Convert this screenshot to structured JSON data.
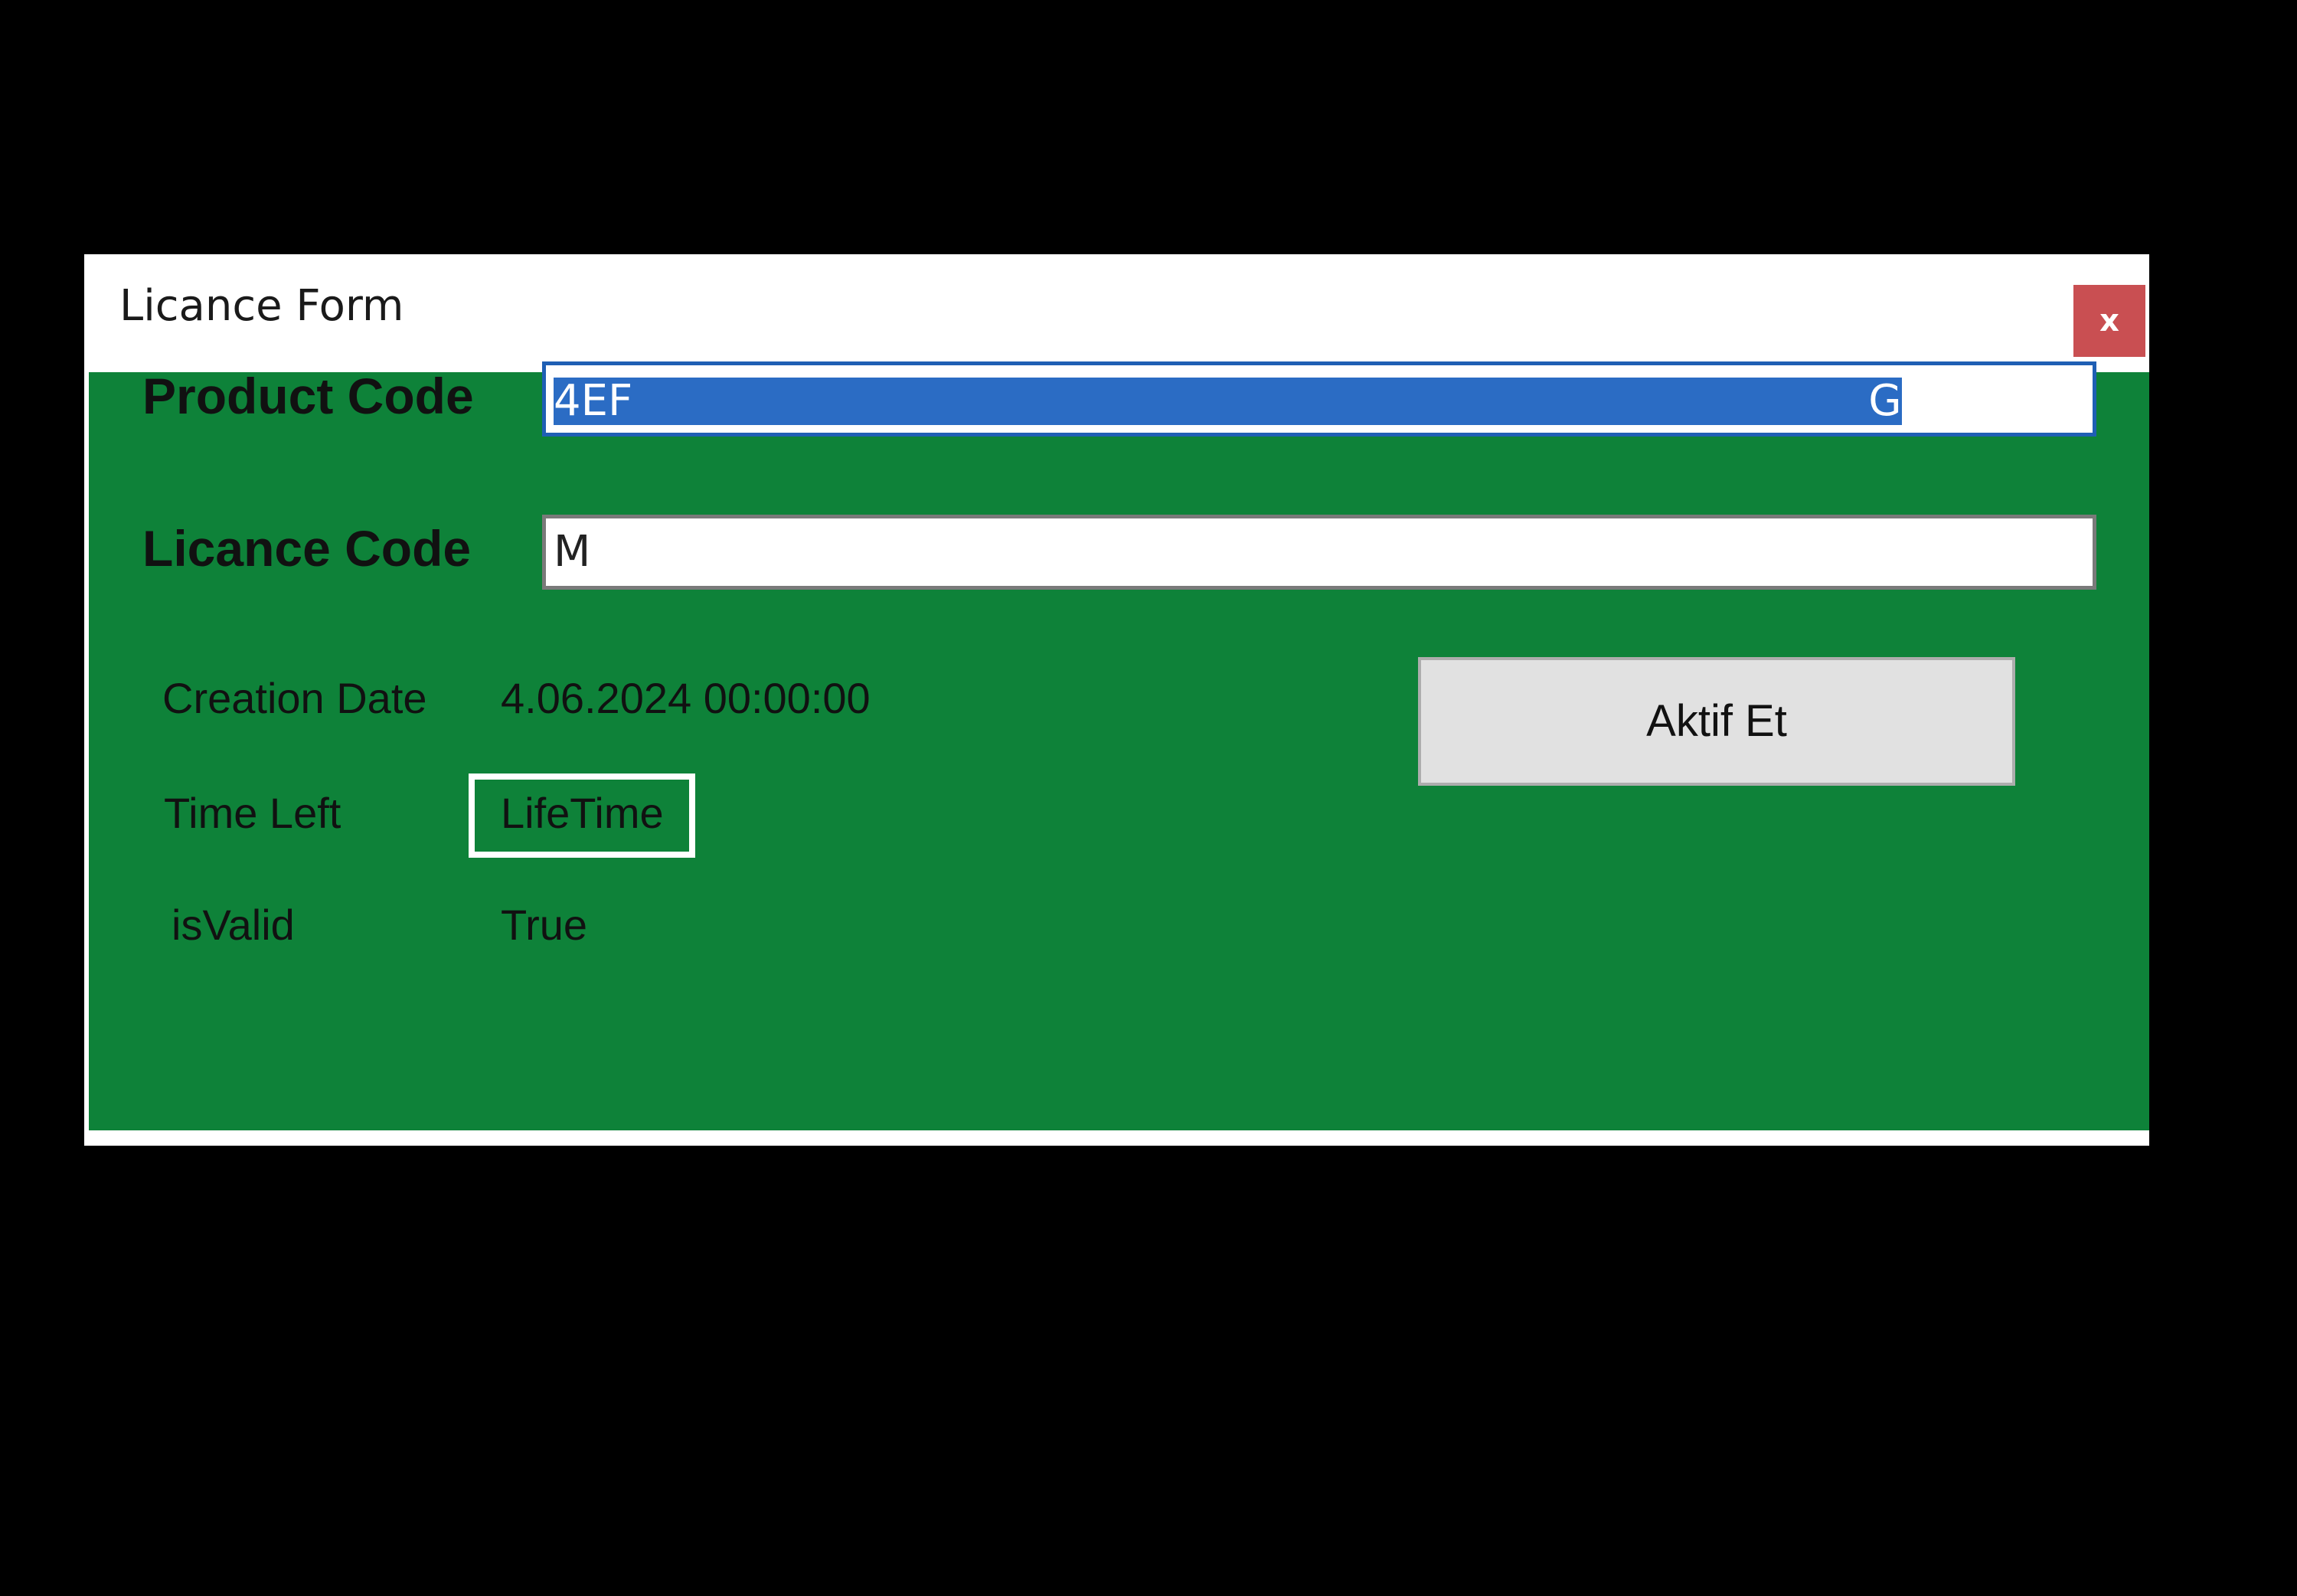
{
  "window": {
    "title": "Licance Form",
    "close_label": "x"
  },
  "form": {
    "product_code": {
      "label": "Product Code",
      "value_start": "4EF",
      "value_end": "G"
    },
    "licance_code": {
      "label": "Licance Code",
      "value_start": "M"
    },
    "creation_date": {
      "label": "Creation Date",
      "value": "4.06.2024 00:00:00"
    },
    "time_left": {
      "label": "Time Left",
      "value": "LifeTime"
    },
    "is_valid": {
      "label": "isValid",
      "value": "True"
    },
    "activate_button": {
      "label": "Aktif Et"
    }
  },
  "colors": {
    "form_background": "#0e8239",
    "close_button": "#c94f52",
    "selection": "#2b6cc4",
    "button_face": "#e1e1e1"
  }
}
